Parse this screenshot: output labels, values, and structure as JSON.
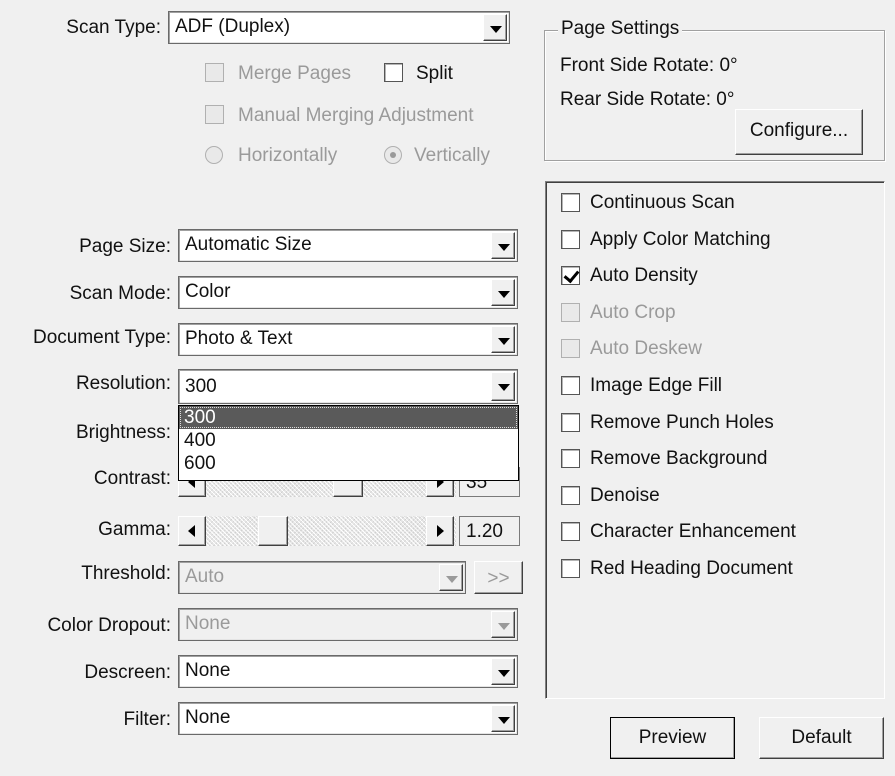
{
  "scan_type": {
    "label": "Scan Type:",
    "value": "ADF (Duplex)"
  },
  "merge_pages": {
    "label": "Merge Pages",
    "checked": false,
    "enabled": false
  },
  "split": {
    "label": "Split",
    "checked": false,
    "enabled": true
  },
  "manual_merge": {
    "label": "Manual Merging Adjustment",
    "checked": false,
    "enabled": false
  },
  "radio_horizontal": {
    "label": "Horizontally",
    "selected": false
  },
  "radio_vertical": {
    "label": "Vertically",
    "selected": true
  },
  "page_settings": {
    "title": "Page Settings",
    "front": "Front Side Rotate: 0°",
    "rear": "Rear Side Rotate: 0°",
    "configure_label": "Configure..."
  },
  "page_size": {
    "label": "Page Size:",
    "value": "Automatic Size"
  },
  "scan_mode": {
    "label": "Scan Mode:",
    "value": "Color"
  },
  "document_type": {
    "label": "Document Type:",
    "value": "Photo & Text"
  },
  "resolution": {
    "label": "Resolution:",
    "value": "300",
    "options": [
      "300",
      "400",
      "600"
    ],
    "selected_index": 0
  },
  "brightness": {
    "label": "Brightness:"
  },
  "contrast": {
    "label": "Contrast:",
    "value": "35"
  },
  "gamma": {
    "label": "Gamma:",
    "value": "1.20"
  },
  "threshold": {
    "label": "Threshold:",
    "value": "Auto",
    "more_label": ">>"
  },
  "color_dropout": {
    "label": "Color Dropout:",
    "value": "None"
  },
  "descreen": {
    "label": "Descreen:",
    "value": "None"
  },
  "filter": {
    "label": "Filter:",
    "value": "None"
  },
  "options": [
    {
      "label": "Continuous Scan",
      "checked": false,
      "enabled": true
    },
    {
      "label": "Apply Color Matching",
      "checked": false,
      "enabled": true
    },
    {
      "label": "Auto Density",
      "checked": true,
      "enabled": true
    },
    {
      "label": "Auto Crop",
      "checked": false,
      "enabled": false
    },
    {
      "label": "Auto Deskew",
      "checked": false,
      "enabled": false
    },
    {
      "label": "Image Edge Fill",
      "checked": false,
      "enabled": true
    },
    {
      "label": "Remove Punch Holes",
      "checked": false,
      "enabled": true
    },
    {
      "label": "Remove Background",
      "checked": false,
      "enabled": true
    },
    {
      "label": "Denoise",
      "checked": false,
      "enabled": true
    },
    {
      "label": "Character Enhancement",
      "checked": false,
      "enabled": true
    },
    {
      "label": "Red Heading Document",
      "checked": false,
      "enabled": true
    }
  ],
  "buttons": {
    "preview": "Preview",
    "default": "Default"
  }
}
